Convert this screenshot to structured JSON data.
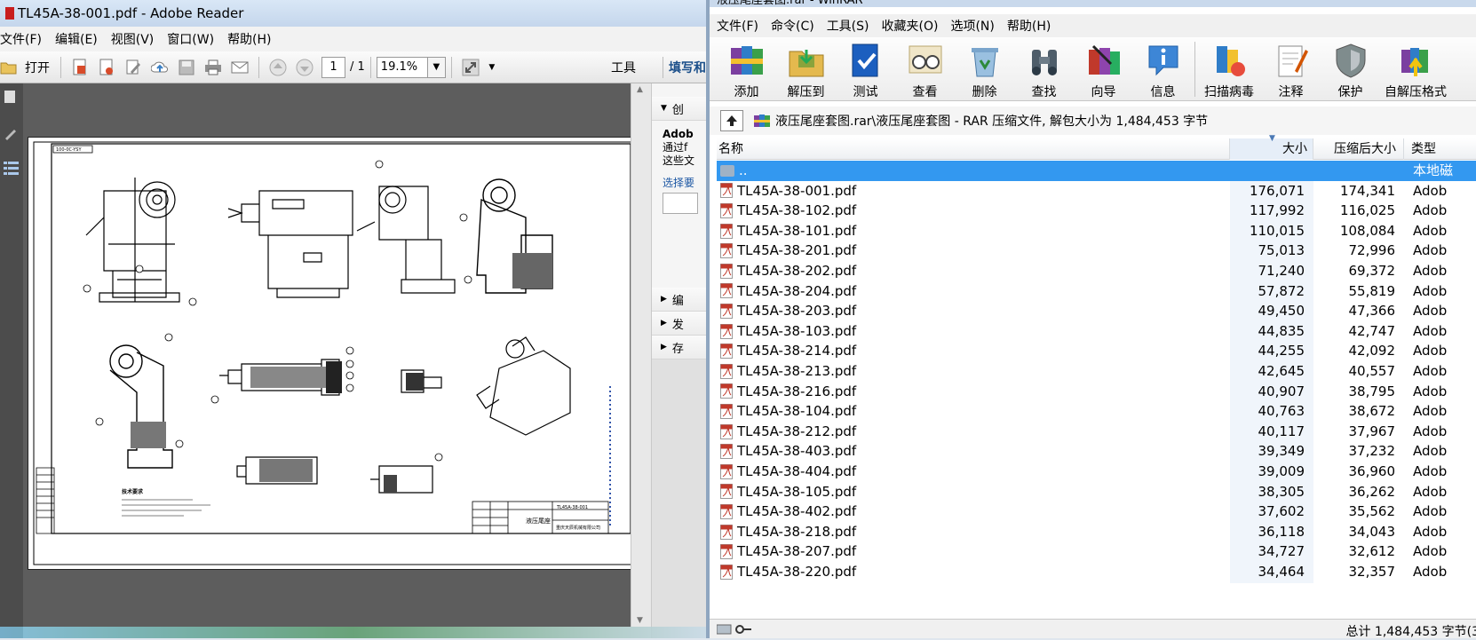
{
  "reader": {
    "title": "TL45A-38-001.pdf - Adobe Reader",
    "menu": [
      "文件(F)",
      "编辑(E)",
      "视图(V)",
      "窗口(W)",
      "帮助(H)"
    ],
    "toolbar": {
      "open_label": "打开",
      "page_current": "1",
      "page_total": "/ 1",
      "zoom": "19.1%",
      "tools_label": "工具",
      "sign_label": "填写和"
    },
    "panel": {
      "create_label": "创",
      "adobe_label": "Adob",
      "desc1": "通过f",
      "desc2": "这些文",
      "select_label": "选择要",
      "edit_label": "编",
      "send_label": "发",
      "store_label": "存"
    },
    "drawing": {
      "title_block_name": "液压尾座",
      "title_block_code": "TL45A-38-001",
      "title_block_company": "重庆天辰机械有限公司",
      "tech_label": "技术要求",
      "corner_label": "100-0C-YSY"
    }
  },
  "winrar": {
    "title": "液压尾座套图.rar - WinRAR",
    "menu": [
      "文件(F)",
      "命令(C)",
      "工具(S)",
      "收藏夹(O)",
      "选项(N)",
      "帮助(H)"
    ],
    "toolbar": [
      "添加",
      "解压到",
      "测试",
      "查看",
      "删除",
      "查找",
      "向导",
      "信息",
      "扫描病毒",
      "注释",
      "保护",
      "自解压格式"
    ],
    "address": "液压尾座套图.rar\\液压尾座套图 - RAR 压缩文件, 解包大小为 1,484,453 字节",
    "columns": {
      "name": "名称",
      "size": "大小",
      "packed": "压缩后大小",
      "type": "类型"
    },
    "parent_row": {
      "name": "..",
      "type": "本地磁"
    },
    "files": [
      {
        "name": "TL45A-38-001.pdf",
        "size": "176,071",
        "packed": "174,341",
        "type": "Adob"
      },
      {
        "name": "TL45A-38-102.pdf",
        "size": "117,992",
        "packed": "116,025",
        "type": "Adob"
      },
      {
        "name": "TL45A-38-101.pdf",
        "size": "110,015",
        "packed": "108,084",
        "type": "Adob"
      },
      {
        "name": "TL45A-38-201.pdf",
        "size": "75,013",
        "packed": "72,996",
        "type": "Adob"
      },
      {
        "name": "TL45A-38-202.pdf",
        "size": "71,240",
        "packed": "69,372",
        "type": "Adob"
      },
      {
        "name": "TL45A-38-204.pdf",
        "size": "57,872",
        "packed": "55,819",
        "type": "Adob"
      },
      {
        "name": "TL45A-38-203.pdf",
        "size": "49,450",
        "packed": "47,366",
        "type": "Adob"
      },
      {
        "name": "TL45A-38-103.pdf",
        "size": "44,835",
        "packed": "42,747",
        "type": "Adob"
      },
      {
        "name": "TL45A-38-214.pdf",
        "size": "44,255",
        "packed": "42,092",
        "type": "Adob"
      },
      {
        "name": "TL45A-38-213.pdf",
        "size": "42,645",
        "packed": "40,557",
        "type": "Adob"
      },
      {
        "name": "TL45A-38-216.pdf",
        "size": "40,907",
        "packed": "38,795",
        "type": "Adob"
      },
      {
        "name": "TL45A-38-104.pdf",
        "size": "40,763",
        "packed": "38,672",
        "type": "Adob"
      },
      {
        "name": "TL45A-38-212.pdf",
        "size": "40,117",
        "packed": "37,967",
        "type": "Adob"
      },
      {
        "name": "TL45A-38-403.pdf",
        "size": "39,349",
        "packed": "37,232",
        "type": "Adob"
      },
      {
        "name": "TL45A-38-404.pdf",
        "size": "39,009",
        "packed": "36,960",
        "type": "Adob"
      },
      {
        "name": "TL45A-38-105.pdf",
        "size": "38,305",
        "packed": "36,262",
        "type": "Adob"
      },
      {
        "name": "TL45A-38-402.pdf",
        "size": "37,602",
        "packed": "35,562",
        "type": "Adob"
      },
      {
        "name": "TL45A-38-218.pdf",
        "size": "36,118",
        "packed": "34,043",
        "type": "Adob"
      },
      {
        "name": "TL45A-38-207.pdf",
        "size": "34,727",
        "packed": "32,612",
        "type": "Adob"
      },
      {
        "name": "TL45A-38-220.pdf",
        "size": "34,464",
        "packed": "32,357",
        "type": "Adob"
      }
    ],
    "status": "总计 1,484,453 字节(3"
  }
}
